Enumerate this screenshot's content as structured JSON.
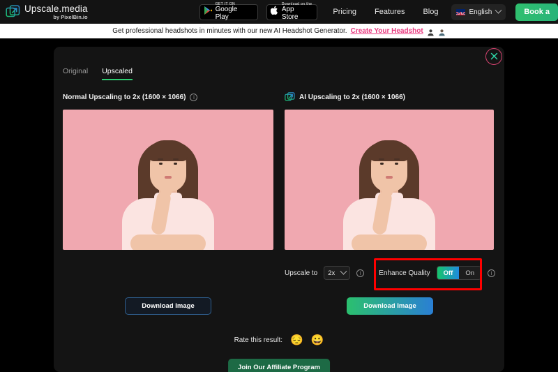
{
  "nav": {
    "brand_title": "Upscale.media",
    "brand_sub": "by PixelBin.io",
    "brand_icon": "upscale-arrow-icon",
    "google_play": {
      "top": "GET IT ON",
      "bottom": "Google Play",
      "icon": "google-play-icon"
    },
    "app_store": {
      "top": "Download on the",
      "bottom": "App Store",
      "icon": "apple-icon"
    },
    "links": [
      {
        "label": "Pricing"
      },
      {
        "label": "Features"
      },
      {
        "label": "Blog"
      }
    ],
    "language": {
      "label": "English",
      "flag": "uk-flag-icon",
      "chevron": "chevron-down-icon"
    },
    "cta": {
      "label": "Book a"
    }
  },
  "banner": {
    "text": "Get professional headshots in minutes with our new AI Headshot Generator.",
    "link": "Create Your Headshot",
    "avatar_icons": [
      "avatar-icon-1",
      "avatar-icon-2"
    ]
  },
  "modal": {
    "close_icon": "close-x-icon",
    "tabs": [
      {
        "label": "Original",
        "active": false
      },
      {
        "label": "Upscaled",
        "active": true
      }
    ],
    "left": {
      "title": "Normal Upscaling to 2x (1600 × 1066)",
      "info_icon": "info-icon",
      "download_label": "Download Image"
    },
    "right": {
      "icon": "upscale-arrow-icon",
      "title": "AI Upscaling to 2x (1600 × 1066)",
      "upscale_label": "Upscale to",
      "upscale_value": "2x",
      "upscale_chevron": "chevron-down-icon",
      "upscale_info_icon": "info-icon",
      "enhance_label": "Enhance Quality",
      "enhance_options": [
        {
          "label": "Off",
          "selected": true
        },
        {
          "label": "On",
          "selected": false
        }
      ],
      "enhance_info_icon": "info-icon",
      "download_label": "Download Image"
    },
    "rate": {
      "label": "Rate this result:",
      "emojis": [
        "😔",
        "😀"
      ]
    },
    "affiliate_label": "Join Our Affiliate Program"
  },
  "colors": {
    "accent_green": "#2ecc71",
    "accent_blue": "#2a7fd4",
    "banner_link_pink": "#e8397f",
    "highlight_red": "#ff0000",
    "photo_background": "#f0a8b0"
  }
}
